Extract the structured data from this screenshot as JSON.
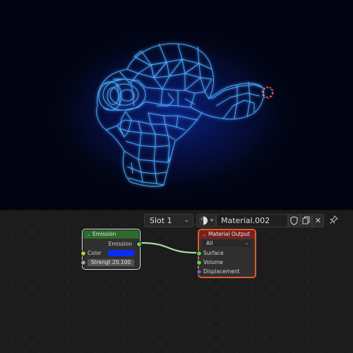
{
  "viewport": {
    "background": "#020818",
    "wire_color": "#4aa8ff",
    "glow_color": "#1a4cff",
    "cursor_color": "#e04040"
  },
  "header": {
    "slot_label": "Slot 1",
    "material_name": "Material.002",
    "icons": [
      "material-ball-icon",
      "shield-icon",
      "duplicate-icon",
      "close-icon",
      "pin-icon"
    ]
  },
  "nodes": {
    "emission": {
      "title": "Emission",
      "header_color": "#2e6a2e",
      "output_label": "Emission",
      "color_label": "Color",
      "color_value": "#0b2cf5",
      "strength_label": "Strengt",
      "strength_value": "20.100"
    },
    "material_output": {
      "title": "Material Output",
      "header_color": "#7a2120",
      "target": "All",
      "inputs": [
        "Surface",
        "Volume",
        "Displacement"
      ]
    }
  }
}
